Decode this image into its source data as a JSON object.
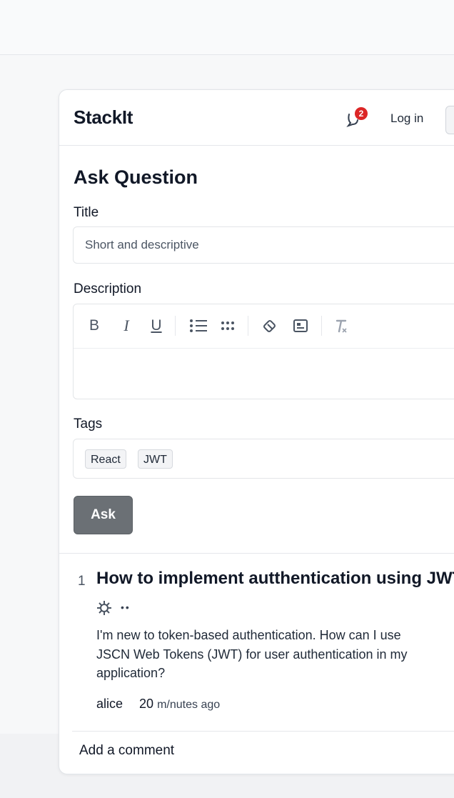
{
  "header": {
    "brand": "StackIt",
    "notification_count": "2",
    "login_label": "Log in"
  },
  "form": {
    "title": "Ask Question",
    "title_label": "Title",
    "title_placeholder": "Short and descriptive",
    "description_label": "Description",
    "toolbar": {
      "bold": "B",
      "italic": "I",
      "underline": "U"
    },
    "tags_label": "Tags",
    "tags": [
      "React",
      "JWT"
    ],
    "ask_label": "Ask"
  },
  "question": {
    "number": "1",
    "title": "How to implement autthentication using JWT",
    "body_lines": [
      "I'm new to token-based authentication. How can I use",
      "JSCN Web Tokens (JWT) for user authentication in my",
      "application?"
    ],
    "author": "alice",
    "time_value": "20",
    "time_unit": "m/nutes ago"
  },
  "comment_placeholder": "Add a comment",
  "icons": {
    "notification": "bell-chat-icon",
    "list_bullet": "bullet-list-icon",
    "list_grid": "dotted-list-icon",
    "link": "link-icon",
    "image": "image-icon",
    "clear_format": "clear-format-icon",
    "question_icon": "gear-icon"
  },
  "colors": {
    "accent_button": "#6b7075",
    "badge": "#dc2626"
  }
}
